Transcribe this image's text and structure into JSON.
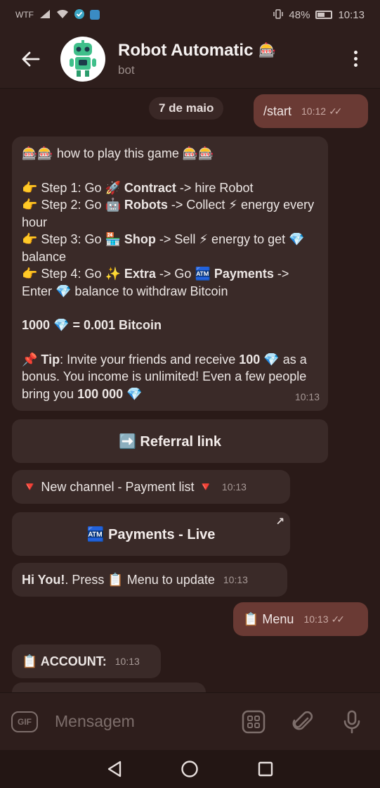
{
  "status": {
    "carrier": "WTF",
    "battery": "48%",
    "time": "10:13"
  },
  "header": {
    "title": "Robot Automatic",
    "title_emoji": "🎰",
    "subtitle": "bot"
  },
  "chat": {
    "date": "7 de maio",
    "messages": [
      {
        "dir": "out",
        "text": "/start",
        "time": "10:12"
      },
      {
        "dir": "in",
        "lines": {
          "l1_a": "🎰🎰 how to play this game 🎰🎰",
          "s1_a": "👉 Step 1: Go 🚀 ",
          "s1_b": "Contract",
          "s1_c": " -> hire Robot",
          "s2_a": "👉 Step 2: Go 🤖 ",
          "s2_b": "Robots",
          "s2_c": " -> Collect ⚡ energy every hour",
          "s3_a": "👉 Step 3: Go 🏪 ",
          "s3_b": "Shop",
          "s3_c": " -> Sell ⚡ energy to get 💎 balance",
          "s4_a": "👉 Step 4: Go ✨ ",
          "s4_b": "Extra",
          "s4_c": " -> Go 🏧 ",
          "s4_d": "Payments",
          "s4_e": " -> Enter 💎 balance to withdraw Bitcoin",
          "rate": "1000 💎 = 0.001 Bitcoin",
          "tip_a": "📌 ",
          "tip_b": "Tip",
          "tip_c": ": Invite your friends and receive ",
          "tip_d": "100",
          "tip_e": " 💎 as a bonus. You income is unlimited! Even a few people bring you  ",
          "tip_f": "100 000",
          "tip_g": " 💎"
        },
        "time": "10:13"
      },
      {
        "dir": "button",
        "text": "➡️ Referral link"
      },
      {
        "dir": "in",
        "text": "🔻 New channel - Payment list 🔻",
        "time": "10:13"
      },
      {
        "dir": "button",
        "text": "🏧 Payments - Live",
        "corner": "↗"
      },
      {
        "dir": "in",
        "text_a": "Hi You!",
        "text_b": ". Press 📋 Menu to update",
        "time": "10:13"
      },
      {
        "dir": "out",
        "text": "📋 Menu",
        "time": "10:13"
      },
      {
        "dir": "in",
        "text": "📋 ACCOUNT:",
        "time": "10:13"
      }
    ]
  },
  "input": {
    "gif_label": "GIF",
    "placeholder": "Mensagem"
  },
  "colors": {
    "background": "#2a1a18",
    "bar": "#2e1e1c",
    "bubble_in": "#3a2a28",
    "bubble_out": "#6a3a34"
  }
}
